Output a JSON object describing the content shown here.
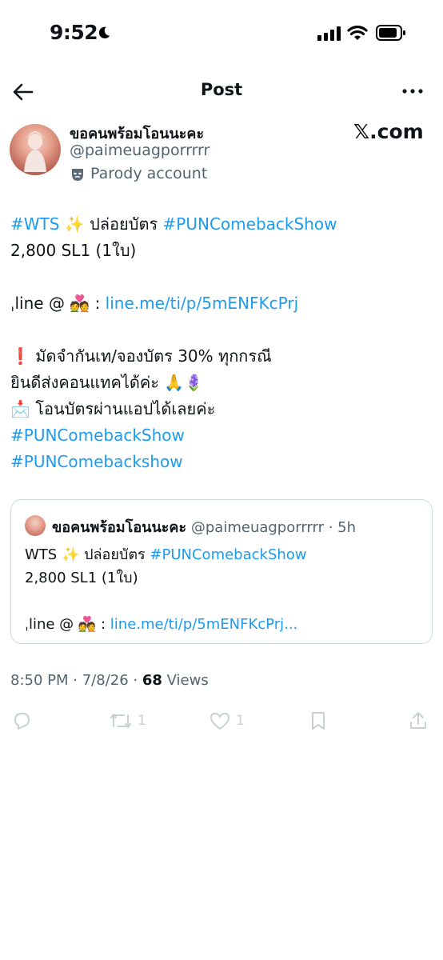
{
  "status_bar": {
    "time": "9:52"
  },
  "nav": {
    "title": "Post"
  },
  "author": {
    "display_name": "ขอคนพร้อมโอนนะคะ",
    "handle": "@paimeuagporrrrr",
    "label": "Parody account",
    "label_icon": "mask-icon"
  },
  "watermark": "𝕏.com",
  "tweet": {
    "lines": [
      {
        "parts": [
          {
            "t": "#WTS",
            "link": true
          },
          {
            "t": " ✨ ",
            "link": false
          },
          {
            "t": "ปล่อยบัตร ",
            "link": false
          },
          {
            "t": "#PUNComebackShow",
            "link": true
          }
        ]
      },
      {
        "parts": [
          {
            "t": "2,800 SL1 (1ใบ)",
            "link": false
          }
        ]
      },
      {
        "parts": [
          {
            "t": "",
            "link": false
          }
        ]
      },
      {
        "parts": [
          {
            "t": "ˌline @  ",
            "link": false
          },
          {
            "t": "💑",
            "link": false
          },
          {
            "t": " : ",
            "link": false
          },
          {
            "t": "line.me/ti/p/5mENFKcPrj",
            "link": true
          }
        ]
      },
      {
        "parts": [
          {
            "t": "",
            "link": false
          }
        ]
      },
      {
        "parts": [
          {
            "t": "❗ ",
            "link": false
          },
          {
            "t": "มัดจำกันเท/จองบัตร 30% ทุกกรณี",
            "link": false
          }
        ]
      },
      {
        "parts": [
          {
            "t": "ยินดีส่งคอนแทคได้ค่ะ 🙏🪻",
            "link": false
          }
        ]
      },
      {
        "parts": [
          {
            "t": "📩 ",
            "link": false
          },
          {
            "t": "โอนบัตรผ่านแอปได้เลยค่ะ",
            "link": false
          }
        ]
      },
      {
        "parts": [
          {
            "t": "#PUNComebackShow",
            "link": true
          }
        ]
      },
      {
        "parts": [
          {
            "t": "#PUNComebackshow",
            "link": true
          }
        ]
      }
    ]
  },
  "quote": {
    "name": "ขอคนพร้อมโอนนะคะ",
    "handle": "@paimeuagporrrrr",
    "time": "5h",
    "lines": [
      {
        "parts": [
          {
            "t": "WTS ✨ ปล่อยบัตร ",
            "link": false
          },
          {
            "t": "#PUNComebackShow",
            "link": true
          }
        ]
      },
      {
        "parts": [
          {
            "t": "2,800 SL1 (1ใบ)",
            "link": false
          }
        ]
      },
      {
        "parts": [
          {
            "t": "",
            "link": false
          }
        ]
      },
      {
        "parts": [
          {
            "t": "ˌline @   💑 : ",
            "link": false
          },
          {
            "t": "line.me/ti/p/5mENFKcPrj...",
            "link": true
          }
        ]
      }
    ]
  },
  "meta": {
    "time": "8:50 PM",
    "date": "7/8/26",
    "views": "68",
    "views_label": "Views"
  },
  "actions": {
    "reply": {
      "icon": "reply-icon",
      "count": ""
    },
    "repost": {
      "icon": "repost-icon",
      "count": "1"
    },
    "like": {
      "icon": "heart-icon",
      "count": "1"
    },
    "bookmark": {
      "icon": "bookmark-icon",
      "count": ""
    },
    "share": {
      "icon": "share-icon",
      "count": ""
    }
  }
}
